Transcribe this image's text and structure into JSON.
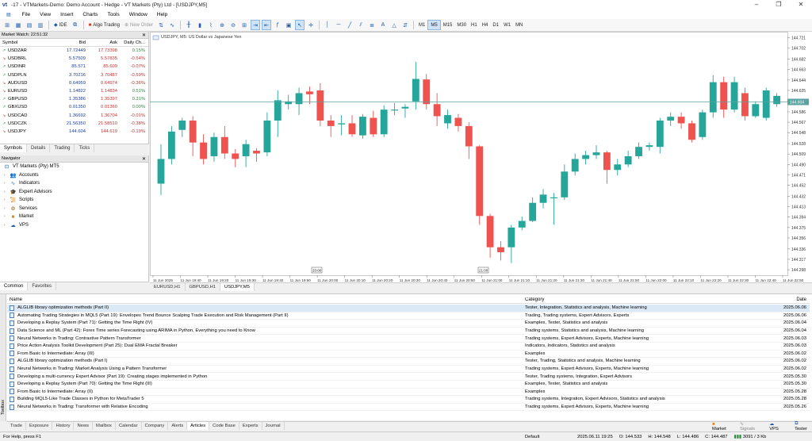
{
  "window": {
    "title": "-17 - VTMarkets-Demo: Demo Account - Hedge - VT Markets (Pty) Ltd - [USDJPY,M5]"
  },
  "menu": [
    "File",
    "View",
    "Insert",
    "Charts",
    "Tools",
    "Window",
    "Help"
  ],
  "toolbar": {
    "ide": "IDE",
    "algo": "Algo Trading",
    "new_order": "New Order",
    "timeframes": [
      "M1",
      "M5",
      "M15",
      "M30",
      "H1",
      "H4",
      "D1",
      "W1",
      "MN"
    ]
  },
  "market_watch": {
    "title": "Market Watch: 22:51:32",
    "headers": [
      "Symbol",
      "Bid",
      "Ask",
      "Daily Ch..."
    ],
    "rows": [
      {
        "symbol": "USDZAR",
        "bid": "17.72449",
        "ask": "17.73398",
        "chg": "0.15%",
        "dir": "up"
      },
      {
        "symbol": "USDBRL",
        "bid": "5.57509",
        "ask": "5.57835",
        "chg": "-0.54%",
        "dir": "dn"
      },
      {
        "symbol": "USDINR",
        "bid": "85.571",
        "ask": "85.609",
        "chg": "-0.07%",
        "dir": "up"
      },
      {
        "symbol": "USDPLN",
        "bid": "3.70216",
        "ask": "3.70487",
        "chg": "-0.59%",
        "dir": "up"
      },
      {
        "symbol": "AUDUSD",
        "bid": "0.64959",
        "ask": "0.64974",
        "chg": "-0.36%",
        "dir": "dn"
      },
      {
        "symbol": "EURUSD",
        "bid": "1.14822",
        "ask": "1.14834",
        "chg": "0.51%",
        "dir": "dn"
      },
      {
        "symbol": "GBPUSD",
        "bid": "1.35386",
        "ask": "1.35397",
        "chg": "0.31%",
        "dir": "up"
      },
      {
        "symbol": "GBXUSD",
        "bid": "0.01350",
        "ask": "0.01360",
        "chg": "0.00%",
        "dir": "up"
      },
      {
        "symbol": "USDCAD",
        "bid": "1.36692",
        "ask": "1.36704",
        "chg": "-0.01%",
        "dir": "dn"
      },
      {
        "symbol": "USDCZK",
        "bid": "21.56350",
        "ask": "21.58510",
        "chg": "-0.38%",
        "dir": "up"
      },
      {
        "symbol": "USDJPY",
        "bid": "144.604",
        "ask": "144.619",
        "chg": "-0.19%",
        "dir": "dn"
      }
    ],
    "tabs": [
      "Symbols",
      "Details",
      "Trading",
      "Ticks"
    ]
  },
  "navigator": {
    "title": "Navigator",
    "items": [
      {
        "label": "VT Markets (Pty) MT5",
        "icon": "broker-icon"
      },
      {
        "label": "Accounts",
        "icon": "accounts-icon"
      },
      {
        "label": "Indicators",
        "icon": "indicators-icon"
      },
      {
        "label": "Expert Advisors",
        "icon": "expert-icon"
      },
      {
        "label": "Scripts",
        "icon": "scripts-icon"
      },
      {
        "label": "Services",
        "icon": "services-icon"
      },
      {
        "label": "Market",
        "icon": "market-icon"
      },
      {
        "label": "VPS",
        "icon": "vps-icon"
      }
    ],
    "tabs": [
      "Common",
      "Favorites"
    ]
  },
  "chart_data": {
    "type": "candlestick",
    "title": "USDJPY, M5: US Dollar vs Japanese Yen",
    "current_price": "144.604",
    "ylim": [
      144.288,
      144.732
    ],
    "y_ticks": [
      "144.721",
      "144.702",
      "144.682",
      "144.663",
      "144.644",
      "144.625",
      "144.606",
      "144.586",
      "144.567",
      "144.548",
      "144.528",
      "144.509",
      "144.490",
      "144.471",
      "144.452",
      "144.432",
      "144.413",
      "144.394",
      "144.375",
      "144.356",
      "144.336",
      "144.317",
      "144.298"
    ],
    "x_ticks": [
      "11 Jun 2025",
      "11 Jun 19:40",
      "11 Jun 19:20",
      "11 Jun 19:30",
      "11 Jun 19:40",
      "11 Jun 19:50",
      "11 Jun 20:00",
      "11 Jun 20:10",
      "11 Jun 20:20",
      "11 Jun 20:30",
      "11 Jun 20:40",
      "11 Jun 20:50",
      "11 Jun 21:00",
      "11 Jun 21:10",
      "11 Jun 21:20",
      "11 Jun 21:30",
      "11 Jun 21:40",
      "11 Jun 21:50",
      "11 Jun 22:00",
      "11 Jun 22:10",
      "11 Jun 22:20",
      "11 Jun 22:30",
      "11 Jun 22:40",
      "11 Jun 22:50"
    ],
    "markers": [
      "20:00",
      "21:00"
    ],
    "candles": [
      [
        144.455,
        144.5,
        144.434,
        144.527
      ],
      [
        144.5,
        144.55,
        144.49,
        144.56
      ],
      [
        144.553,
        144.57,
        144.54,
        144.575
      ],
      [
        144.57,
        144.53,
        144.505,
        144.578
      ],
      [
        144.53,
        144.5,
        144.49,
        144.545
      ],
      [
        144.505,
        144.54,
        144.495,
        144.548
      ],
      [
        144.54,
        144.51,
        144.5,
        144.56
      ],
      [
        144.51,
        144.5,
        144.485,
        144.518
      ],
      [
        144.505,
        144.527,
        144.485,
        144.535
      ],
      [
        144.515,
        144.51,
        144.495,
        144.52
      ],
      [
        144.512,
        144.57,
        144.505,
        144.585
      ],
      [
        144.57,
        144.607,
        144.54,
        144.625
      ],
      [
        144.6,
        144.605,
        144.59,
        144.617
      ],
      [
        144.6,
        144.62,
        144.58,
        144.63
      ],
      [
        144.623,
        144.618,
        144.6,
        144.632
      ],
      [
        144.625,
        144.57,
        144.56,
        144.638
      ],
      [
        144.57,
        144.56,
        144.54,
        144.58
      ],
      [
        144.563,
        144.565,
        144.543,
        144.58
      ],
      [
        144.565,
        144.545,
        144.54,
        144.58
      ],
      [
        144.543,
        144.577,
        144.537,
        144.582
      ],
      [
        144.575,
        144.545,
        144.54,
        144.588
      ],
      [
        144.545,
        144.59,
        144.54,
        144.598
      ],
      [
        144.59,
        144.59,
        144.58,
        144.602
      ],
      [
        144.592,
        144.595,
        144.575,
        144.6
      ],
      [
        144.605,
        144.646,
        144.59,
        144.677
      ],
      [
        144.645,
        144.6,
        144.59,
        144.655
      ],
      [
        144.6,
        144.578,
        144.56,
        144.62
      ],
      [
        144.565,
        144.58,
        144.555,
        144.59
      ],
      [
        144.575,
        144.56,
        144.55,
        144.582
      ],
      [
        144.56,
        144.523,
        144.5,
        144.567
      ],
      [
        144.523,
        144.396,
        144.38,
        144.525
      ],
      [
        144.396,
        144.339,
        144.32,
        144.4
      ],
      [
        144.339,
        144.33,
        144.315,
        144.35
      ],
      [
        144.339,
        144.375,
        144.31,
        144.38
      ],
      [
        144.375,
        144.387,
        144.37,
        144.395
      ],
      [
        144.387,
        144.42,
        144.385,
        144.43
      ],
      [
        144.42,
        144.435,
        144.41,
        144.445
      ],
      [
        144.43,
        144.43,
        144.38,
        144.438
      ],
      [
        144.43,
        144.477,
        144.425,
        144.49
      ],
      [
        144.477,
        144.5,
        144.47,
        144.51
      ],
      [
        144.5,
        144.507,
        144.49,
        144.515
      ],
      [
        144.507,
        144.512,
        144.5,
        144.525
      ],
      [
        144.512,
        144.48,
        144.455,
        144.515
      ],
      [
        144.48,
        144.49,
        144.47,
        144.5
      ],
      [
        144.49,
        144.505,
        144.485,
        144.515
      ],
      [
        144.505,
        144.522,
        144.5,
        144.53
      ],
      [
        144.522,
        144.525,
        144.515,
        144.53
      ],
      [
        144.522,
        144.57,
        144.51,
        144.575
      ],
      [
        144.57,
        144.577,
        144.56,
        144.585
      ],
      [
        144.577,
        144.565,
        144.555,
        144.585
      ],
      [
        144.565,
        144.535,
        144.53,
        144.57
      ],
      [
        144.54,
        144.585,
        144.535,
        144.59
      ],
      [
        144.585,
        144.64,
        144.575,
        144.653
      ],
      [
        144.64,
        144.59,
        144.575,
        144.65
      ],
      [
        144.59,
        144.64,
        144.585,
        144.65
      ],
      [
        144.62,
        144.578,
        144.57,
        144.63
      ],
      [
        144.578,
        144.6,
        144.575,
        144.605
      ],
      [
        144.575,
        144.625,
        144.57,
        144.63
      ],
      [
        144.6,
        144.615,
        144.595,
        144.62
      ]
    ]
  },
  "chart_tabs": [
    "EURUSD,H1",
    "GBPUSD,H1",
    "USDJPY,M5"
  ],
  "articles": {
    "headers": [
      "Name",
      "Category",
      "Date"
    ],
    "rows": [
      {
        "name": "ALGLIB library optimization methods (Part II)",
        "cat": "Tester, Integration, Statistics and analysis, Machine learning",
        "date": "2025.06.06"
      },
      {
        "name": "Automating Trading Strategies in MQL5 (Part 19): Envelopes Trend Bounce Scalping  Trade Execution and Risk Management (Part II)",
        "cat": "Trading, Trading systems, Expert Advisors, Experts",
        "date": "2025.06.06"
      },
      {
        "name": "Developing a Replay System (Part 71): Getting the Time Right (IV)",
        "cat": "Examples, Tester, Statistics and analysis",
        "date": "2025.06.04"
      },
      {
        "name": "Data Science and ML (Part 42): Forex Time series Forecasting using ARIMA in Python, Everything you need to Know",
        "cat": "Trading systems, Statistics and analysis, Machine learning",
        "date": "2025.06.04"
      },
      {
        "name": "Neural Networks in Trading: Contrastive Pattern Transformer",
        "cat": "Trading systems, Expert Advisors, Experts, Machine learning",
        "date": "2025.06.03"
      },
      {
        "name": "Price Action Analysis Toolkit Development (Part 25): Dual EMA Fractal Breaker",
        "cat": "Indicators, Indicators, Statistics and analysis",
        "date": "2025.06.03"
      },
      {
        "name": "From Basic to Intermediate: Array (III)",
        "cat": "Examples",
        "date": "2025.06.02"
      },
      {
        "name": "ALGLIB library optimization methods (Part I)",
        "cat": "Tester, Trading, Statistics and analysis, Machine learning",
        "date": "2025.06.02"
      },
      {
        "name": "Neural Networks in Trading: Market Analysis Using a Pattern Transformer",
        "cat": "Trading systems, Expert Advisors, Experts, Machine learning",
        "date": "2025.06.02"
      },
      {
        "name": "Developing a multi-currency Expert Advisor (Part 19): Creating stages implemented in Python",
        "cat": "Tester, Trading systems, Integration, Expert Advisors",
        "date": "2025.05.30"
      },
      {
        "name": "Developing a Replay System (Part 70): Getting the Time Right (III)",
        "cat": "Examples, Tester, Statistics and analysis",
        "date": "2025.05.30"
      },
      {
        "name": "From Basic to Intermediate: Array (II)",
        "cat": "Examples",
        "date": "2025.05.28"
      },
      {
        "name": "Building MQL5-Like Trade Classes in Python for MetaTrader 5",
        "cat": "Trading systems, Integration, Expert Advisors, Statistics and analysis",
        "date": "2025.05.28"
      },
      {
        "name": "Neural Networks in Trading: Transformer with Relative Encoding",
        "cat": "Trading systems, Expert Advisors, Experts, Machine learning",
        "date": "2025.05.26"
      }
    ]
  },
  "bottom_tabs": [
    "Trade",
    "Exposure",
    "History",
    "News",
    "Mailbox",
    "Calendar",
    "Company",
    "Alerts",
    "Articles",
    "Code Base",
    "Experts",
    "Journal"
  ],
  "toolbox_label": "Toolbox",
  "right_buttons": [
    "Market",
    "Signals",
    "VPS",
    "Tester"
  ],
  "status": {
    "help": "For Help, press F1",
    "profile": "Default",
    "time": "2025.06.11 19:25",
    "o": "O: 144.533",
    "h": "H: 144.548",
    "l": "L: 144.486",
    "c": "C: 144.487",
    "traffic": "3091 / 3 Kb"
  },
  "colors": {
    "bull": "#26a69a",
    "bear": "#ef5350",
    "price_line": "#5aa3a0",
    "accent": "#1e5aa8"
  }
}
